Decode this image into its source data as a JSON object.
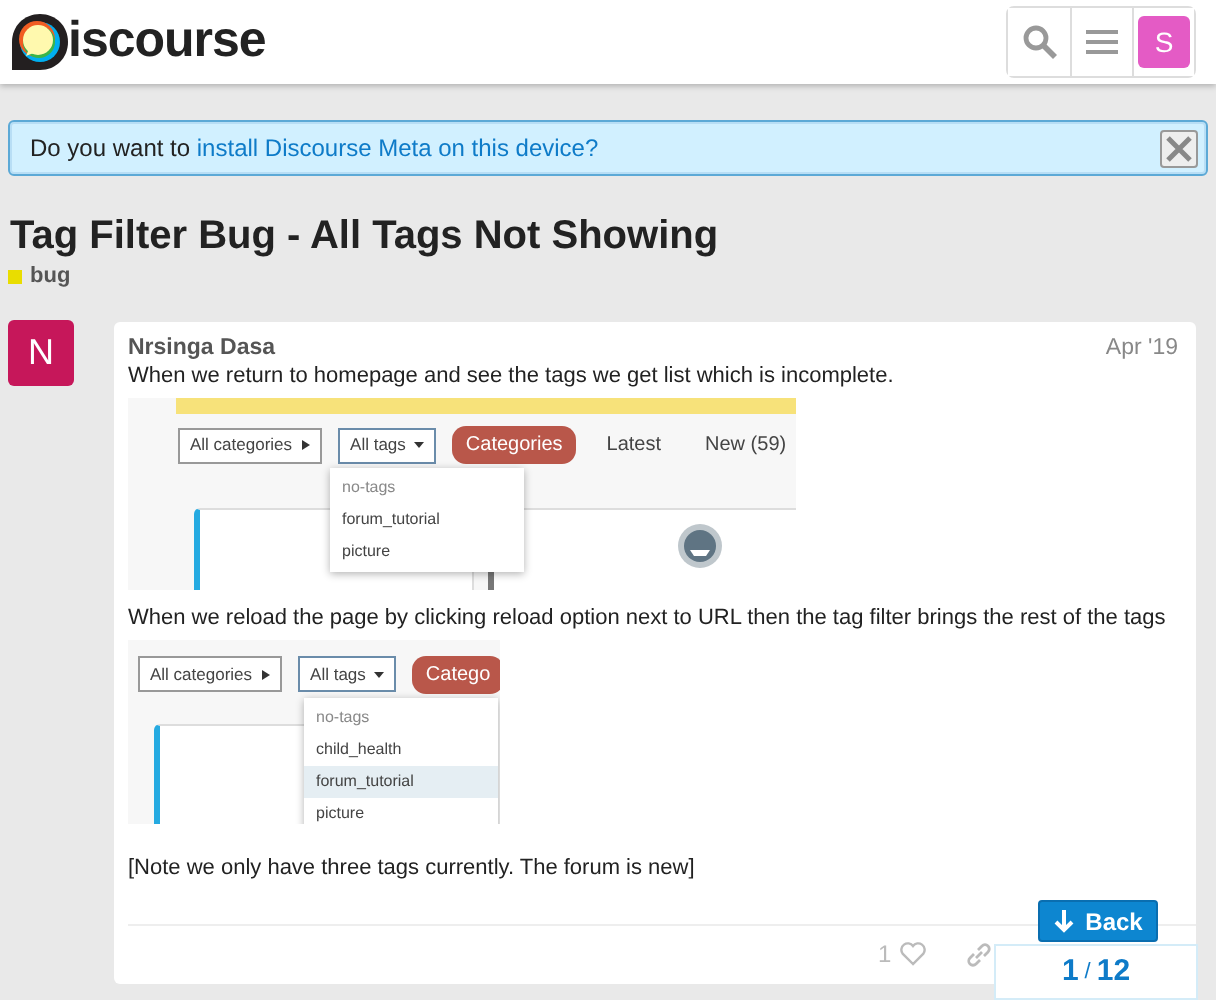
{
  "header": {
    "logo_text": "iscourse",
    "avatar_letter": "S"
  },
  "banner": {
    "text": "Do you want to ",
    "link": "install Discourse Meta on this device?"
  },
  "topic": {
    "title": "Tag Filter Bug - All Tags Not Showing",
    "tags": [
      {
        "label": "bug",
        "color": "#e9dd00"
      }
    ]
  },
  "post": {
    "avatar_letter": "N",
    "username": "Nrsinga Dasa",
    "date": "Apr '19",
    "paragraph_1": "When we return to homepage and see the tags we get list which is incomplete.",
    "screenshot_1": {
      "category_button": "All categories",
      "tags_button": "All tags",
      "nav": [
        {
          "label": "Categories",
          "selected": true
        },
        {
          "label": "Latest",
          "selected": false
        },
        {
          "label": "New (59)",
          "selected": false
        }
      ],
      "dropdown": [
        {
          "label": "no-tags",
          "muted": true,
          "selected": false
        },
        {
          "label": "forum_tutorial",
          "muted": false,
          "selected": false
        },
        {
          "label": "picture",
          "muted": false,
          "selected": false
        }
      ]
    },
    "paragraph_2": "When we reload the page by clicking reload option next to URL then the tag filter brings the rest of the tags",
    "screenshot_2": {
      "category_button": "All categories",
      "tags_button": "All tags",
      "nav": [
        {
          "label": "Catego",
          "selected": true
        }
      ],
      "dropdown": [
        {
          "label": "no-tags",
          "muted": true,
          "selected": false
        },
        {
          "label": "child_health",
          "muted": false,
          "selected": false
        },
        {
          "label": "forum_tutorial",
          "muted": false,
          "selected": true
        },
        {
          "label": "picture",
          "muted": false,
          "selected": false
        }
      ]
    },
    "paragraph_3": "[Note we only have three tags currently. The forum is new]",
    "like_count": "1"
  },
  "timeline": {
    "back_button": "Back",
    "current": "1",
    "separator": "/",
    "total": "12"
  }
}
